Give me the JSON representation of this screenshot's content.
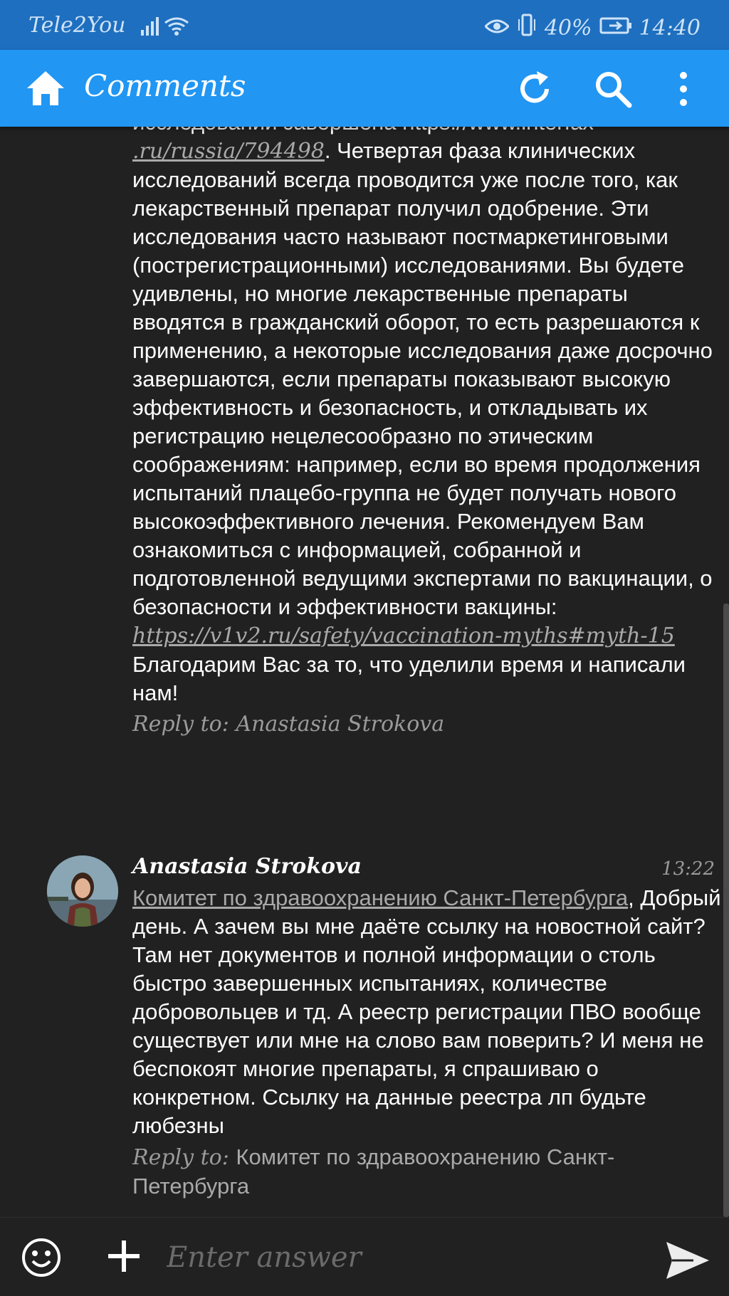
{
  "status_bar": {
    "carrier": "Tele2You",
    "battery": "40%",
    "time": "14:40"
  },
  "app_bar": {
    "title": "Comments",
    "icons": [
      "home-icon",
      "refresh-icon",
      "search-icon",
      "more-vert-icon"
    ]
  },
  "comments": [
    {
      "partial_top": "исследований завершена https://www.interfax",
      "link_tail": ".ru/russia/794498",
      "body": ". Четвертая фаза клинических исследований всегда проводится уже после того, как лекарственный препарат получил одобрение. Эти исследования часто называют постмаркетинговыми (пострегистрационными) исследованиями. Вы будете удивлены, но многие лекарственные препараты вводятся в гражданский оборот, то есть разрешаются к применению, а некоторые исследования даже досрочно завершаются, если препараты показывают высокую эффективность и безопасность, и откладывать их регистрацию нецелесообразно по этическим соображениям: например, если во время продолжения испытаний плацебо-группа не будет получать нового высокоэффективного лечения. Рекомендуем Вам ознакомиться с информацией, собранной и подготовленной ведущими экспертами по вакцинации, о безопасности и эффективности вакцины:",
      "link": "https://v1v2.ru/safety/vaccination-myths#myth-15",
      "closing": "Благодарим Вас за то, что уделили время и написали нам!",
      "reply_label": "Reply to:",
      "reply_target": "Anastasia Strokova"
    },
    {
      "author": "Anastasia Strokova",
      "time": "13:22",
      "mention": "Комитет по здравоохранению Санкт-Петербурга",
      "body": ", Добрый день. А зачем вы мне даёте ссылку на новостной сайт? Там нет документов и полной информации о столь быстро завершенных испытаниях, количестве добровольцев и тд. А реестр регистрации ПВО вообще существует или мне на слово вам поверить? И меня не беспокоят многие препараты, я спрашиваю о конкретном. Ссылку на данные реестра лп будьте любезны",
      "reply_label": "Reply to:",
      "reply_target": "Комитет по здравоохранению Санкт-Петербурга"
    }
  ],
  "composer": {
    "placeholder": "Enter answer",
    "icons": [
      "emoji-icon",
      "plus-icon",
      "send-icon"
    ]
  },
  "colors": {
    "status_bar": "#1e6fbf",
    "app_bar": "#2196f3",
    "background": "#212121"
  }
}
